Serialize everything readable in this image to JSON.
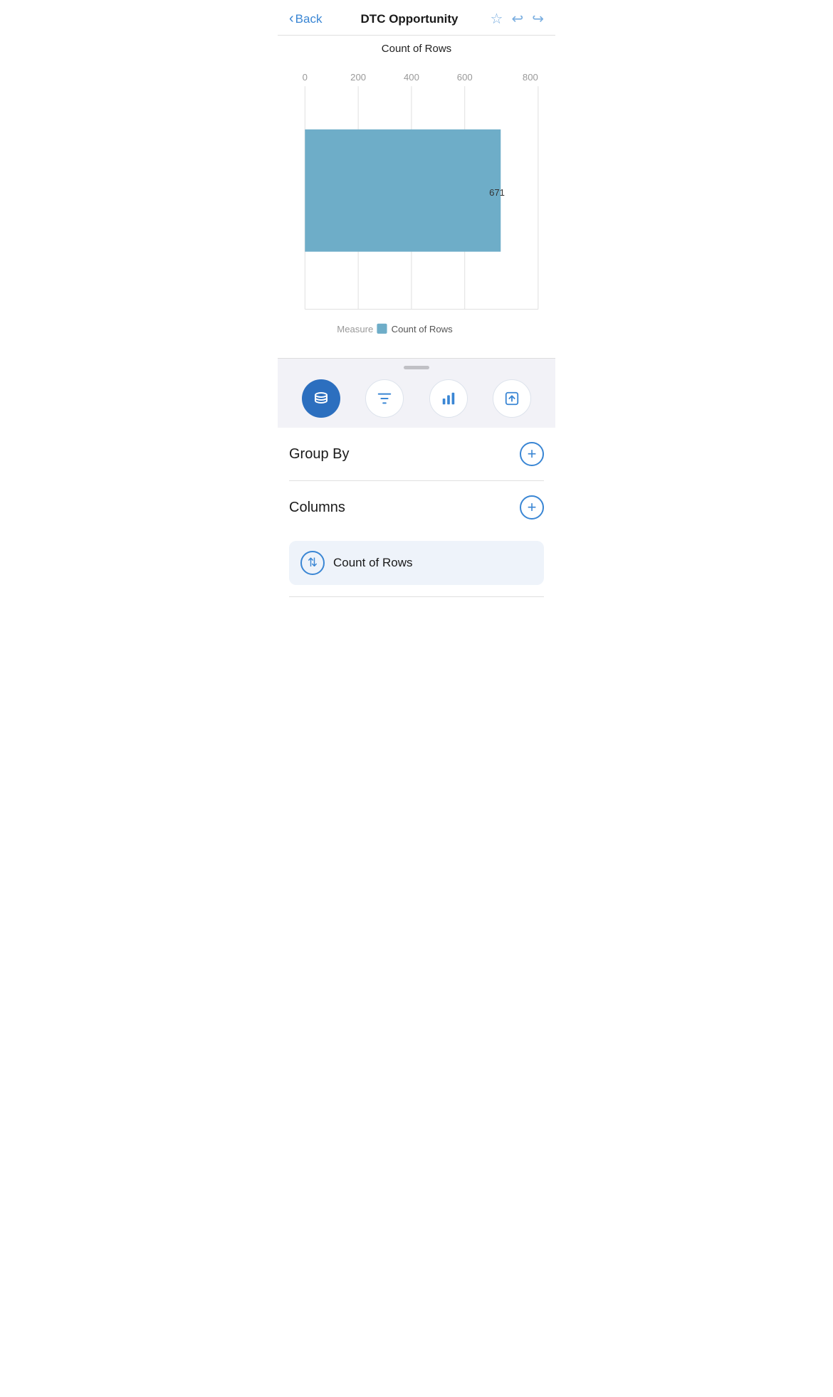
{
  "header": {
    "back_label": "Back",
    "title": "DTC Opportunity",
    "star_icon": "★",
    "undo_icon": "↩",
    "redo_icon": "↪"
  },
  "chart": {
    "title": "Count of Rows",
    "x_labels": [
      "0",
      "200",
      "400",
      "600",
      "800"
    ],
    "bar_value": 671,
    "bar_value_label": "671",
    "bar_color": "#6eadc8",
    "legend_measure": "Measure",
    "legend_label": "Count of Rows",
    "max_value": 800
  },
  "toolbar": {
    "tabs": [
      {
        "name": "data",
        "active": true
      },
      {
        "name": "filter",
        "active": false
      },
      {
        "name": "chart",
        "active": false
      },
      {
        "name": "share",
        "active": false
      }
    ]
  },
  "group_by": {
    "label": "Group By",
    "add_label": "+"
  },
  "columns": {
    "label": "Columns",
    "add_label": "+",
    "items": [
      {
        "icon": "⇅",
        "label": "Count of Rows"
      }
    ]
  },
  "colors": {
    "blue_accent": "#3a86d4",
    "toolbar_active": "#2c6fbf",
    "bar_fill": "#6eadc8",
    "background_section": "#eef3fa"
  }
}
